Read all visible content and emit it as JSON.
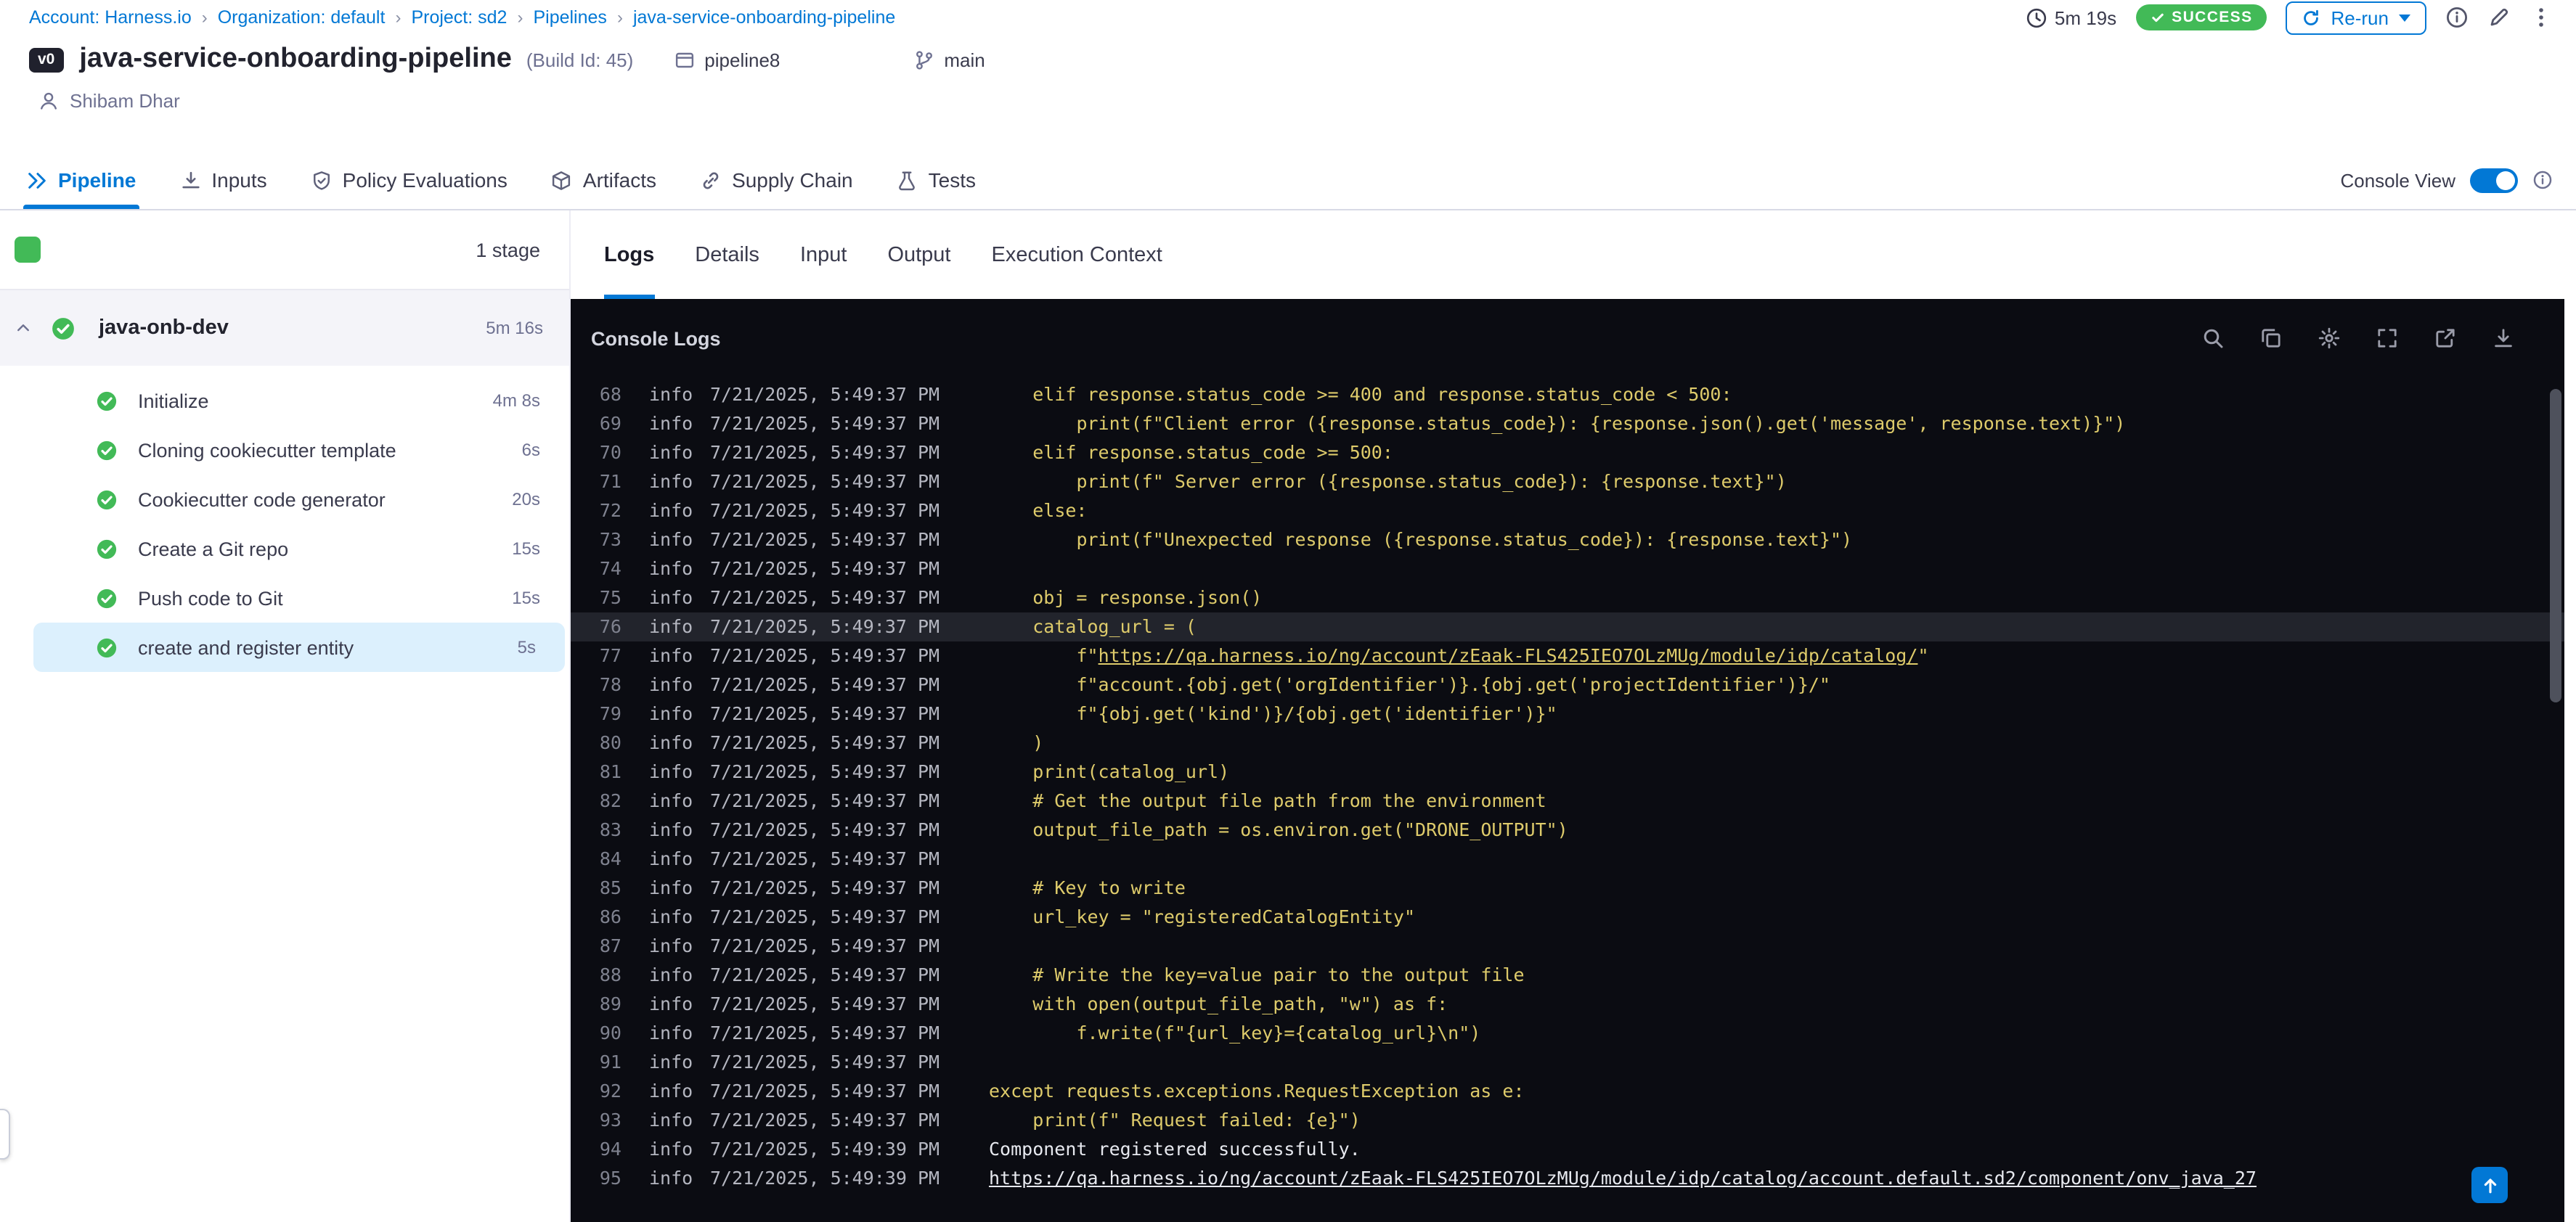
{
  "colors": {
    "accent": "#0278d5",
    "success_green": "#42ba57",
    "log_yellow": "#decb6b",
    "console_bg": "#0b0c12",
    "line_highlight": "#22242c",
    "selected_step_bg": "#dcf0fd"
  },
  "breadcrumb": {
    "separator": "›",
    "items": [
      "Account: Harness.io",
      "Organization: default",
      "Project: sd2",
      "Pipelines",
      "java-service-onboarding-pipeline"
    ]
  },
  "topbar": {
    "duration": "5m 19s",
    "status": "SUCCESS",
    "rerun_label": "Re-run"
  },
  "header": {
    "version_badge": "v0",
    "title": "java-service-onboarding-pipeline",
    "build_id": "(Build Id: 45)",
    "pipeline_tag": "pipeline8",
    "branch": "main",
    "user": "Shibam Dhar"
  },
  "tabs": {
    "console_view_label": "Console View",
    "console_view_on": true,
    "items": [
      {
        "label": "Pipeline",
        "icon": "pipeline-icon",
        "active": true
      },
      {
        "label": "Inputs",
        "icon": "inputs-icon",
        "active": false
      },
      {
        "label": "Policy Evaluations",
        "icon": "policy-evaluations-icon",
        "active": false
      },
      {
        "label": "Artifacts",
        "icon": "artifacts-icon",
        "active": false
      },
      {
        "label": "Supply Chain",
        "icon": "supply-chain-icon",
        "active": false
      },
      {
        "label": "Tests",
        "icon": "tests-icon",
        "active": false
      }
    ]
  },
  "stages": {
    "count_label": "1 stage",
    "group": {
      "name": "java-onb-dev",
      "duration": "5m 16s",
      "status": "success"
    },
    "steps": [
      {
        "name": "Initialize",
        "duration": "4m 8s",
        "status": "success",
        "selected": false
      },
      {
        "name": "Cloning cookiecutter template",
        "duration": "6s",
        "status": "success",
        "selected": false
      },
      {
        "name": "Cookiecutter code generator",
        "duration": "20s",
        "status": "success",
        "selected": false
      },
      {
        "name": "Create a Git repo",
        "duration": "15s",
        "status": "success",
        "selected": false
      },
      {
        "name": "Push code to Git",
        "duration": "15s",
        "status": "success",
        "selected": false
      },
      {
        "name": "create and register entity",
        "duration": "5s",
        "status": "success",
        "selected": true
      }
    ]
  },
  "detail_tabs": {
    "items": [
      {
        "label": "Logs",
        "active": true
      },
      {
        "label": "Details",
        "active": false
      },
      {
        "label": "Input",
        "active": false
      },
      {
        "label": "Output",
        "active": false
      },
      {
        "label": "Execution Context",
        "active": false
      }
    ]
  },
  "console": {
    "title": "Console Logs",
    "actions": [
      {
        "name": "search-icon"
      },
      {
        "name": "copy-icon"
      },
      {
        "name": "settings-icon"
      },
      {
        "name": "fullscreen-icon"
      },
      {
        "name": "open-in-new-icon"
      },
      {
        "name": "download-icon"
      }
    ],
    "lines": [
      {
        "n": 68,
        "level": "info",
        "time": "7/21/2025, 5:49:37 PM",
        "indent": 4,
        "highlight": false,
        "segs": [
          {
            "k": "code",
            "t": "elif response.status_code >= 400 and response.status_code < 500:"
          }
        ]
      },
      {
        "n": 69,
        "level": "info",
        "time": "7/21/2025, 5:49:37 PM",
        "indent": 8,
        "highlight": false,
        "segs": [
          {
            "k": "code",
            "t": "print(f\"Client error ({response.status_code}): {response.json().get('message', response.text)}\")"
          }
        ]
      },
      {
        "n": 70,
        "level": "info",
        "time": "7/21/2025, 5:49:37 PM",
        "indent": 4,
        "highlight": false,
        "segs": [
          {
            "k": "code",
            "t": "elif response.status_code >= 500:"
          }
        ]
      },
      {
        "n": 71,
        "level": "info",
        "time": "7/21/2025, 5:49:37 PM",
        "indent": 8,
        "highlight": false,
        "segs": [
          {
            "k": "code",
            "t": "print(f\" Server error ({response.status_code}): {response.text}\")"
          }
        ]
      },
      {
        "n": 72,
        "level": "info",
        "time": "7/21/2025, 5:49:37 PM",
        "indent": 4,
        "highlight": false,
        "segs": [
          {
            "k": "code",
            "t": "else:"
          }
        ]
      },
      {
        "n": 73,
        "level": "info",
        "time": "7/21/2025, 5:49:37 PM",
        "indent": 8,
        "highlight": false,
        "segs": [
          {
            "k": "code",
            "t": "print(f\"Unexpected response ({response.status_code}): {response.text}\")"
          }
        ]
      },
      {
        "n": 74,
        "level": "info",
        "time": "7/21/2025, 5:49:37 PM",
        "indent": 0,
        "highlight": false,
        "segs": []
      },
      {
        "n": 75,
        "level": "info",
        "time": "7/21/2025, 5:49:37 PM",
        "indent": 4,
        "highlight": false,
        "segs": [
          {
            "k": "code",
            "t": "obj = response.json()"
          }
        ]
      },
      {
        "n": 76,
        "level": "info",
        "time": "7/21/2025, 5:49:37 PM",
        "indent": 4,
        "highlight": true,
        "segs": [
          {
            "k": "code",
            "t": "catalog_url = ("
          }
        ]
      },
      {
        "n": 77,
        "level": "info",
        "time": "7/21/2025, 5:49:37 PM",
        "indent": 8,
        "highlight": false,
        "segs": [
          {
            "k": "code",
            "t": "f\""
          },
          {
            "k": "code-link",
            "t": "https://qa.harness.io/ng/account/zEaak-FLS425IEO7OLzMUg/module/idp/catalog/"
          },
          {
            "k": "code",
            "t": "\""
          }
        ]
      },
      {
        "n": 78,
        "level": "info",
        "time": "7/21/2025, 5:49:37 PM",
        "indent": 8,
        "highlight": false,
        "segs": [
          {
            "k": "code",
            "t": "f\"account.{obj.get('orgIdentifier')}.{obj.get('projectIdentifier')}/\""
          }
        ]
      },
      {
        "n": 79,
        "level": "info",
        "time": "7/21/2025, 5:49:37 PM",
        "indent": 8,
        "highlight": false,
        "segs": [
          {
            "k": "code",
            "t": "f\"{obj.get('kind')}/{obj.get('identifier')}\""
          }
        ]
      },
      {
        "n": 80,
        "level": "info",
        "time": "7/21/2025, 5:49:37 PM",
        "indent": 4,
        "highlight": false,
        "segs": [
          {
            "k": "code",
            "t": ")"
          }
        ]
      },
      {
        "n": 81,
        "level": "info",
        "time": "7/21/2025, 5:49:37 PM",
        "indent": 4,
        "highlight": false,
        "segs": [
          {
            "k": "code",
            "t": "print(catalog_url)"
          }
        ]
      },
      {
        "n": 82,
        "level": "info",
        "time": "7/21/2025, 5:49:37 PM",
        "indent": 4,
        "highlight": false,
        "segs": [
          {
            "k": "code",
            "t": "# Get the output file path from the environment"
          }
        ]
      },
      {
        "n": 83,
        "level": "info",
        "time": "7/21/2025, 5:49:37 PM",
        "indent": 4,
        "highlight": false,
        "segs": [
          {
            "k": "code",
            "t": "output_file_path = os.environ.get(\"DRONE_OUTPUT\")"
          }
        ]
      },
      {
        "n": 84,
        "level": "info",
        "time": "7/21/2025, 5:49:37 PM",
        "indent": 0,
        "highlight": false,
        "segs": []
      },
      {
        "n": 85,
        "level": "info",
        "time": "7/21/2025, 5:49:37 PM",
        "indent": 4,
        "highlight": false,
        "segs": [
          {
            "k": "code",
            "t": "# Key to write"
          }
        ]
      },
      {
        "n": 86,
        "level": "info",
        "time": "7/21/2025, 5:49:37 PM",
        "indent": 4,
        "highlight": false,
        "segs": [
          {
            "k": "code",
            "t": "url_key = \"registeredCatalogEntity\""
          }
        ]
      },
      {
        "n": 87,
        "level": "info",
        "time": "7/21/2025, 5:49:37 PM",
        "indent": 0,
        "highlight": false,
        "segs": []
      },
      {
        "n": 88,
        "level": "info",
        "time": "7/21/2025, 5:49:37 PM",
        "indent": 4,
        "highlight": false,
        "segs": [
          {
            "k": "code",
            "t": "# Write the key=value pair to the output file"
          }
        ]
      },
      {
        "n": 89,
        "level": "info",
        "time": "7/21/2025, 5:49:37 PM",
        "indent": 4,
        "highlight": false,
        "segs": [
          {
            "k": "code",
            "t": "with open(output_file_path, \"w\") as f:"
          }
        ]
      },
      {
        "n": 90,
        "level": "info",
        "time": "7/21/2025, 5:49:37 PM",
        "indent": 8,
        "highlight": false,
        "segs": [
          {
            "k": "code",
            "t": "f.write(f\"{url_key}={catalog_url}\\n\")"
          }
        ]
      },
      {
        "n": 91,
        "level": "info",
        "time": "7/21/2025, 5:49:37 PM",
        "indent": 0,
        "highlight": false,
        "segs": []
      },
      {
        "n": 92,
        "level": "info",
        "time": "7/21/2025, 5:49:37 PM",
        "indent": 0,
        "highlight": false,
        "segs": [
          {
            "k": "code",
            "t": "except requests.exceptions.RequestException as e:"
          }
        ]
      },
      {
        "n": 93,
        "level": "info",
        "time": "7/21/2025, 5:49:37 PM",
        "indent": 4,
        "highlight": false,
        "segs": [
          {
            "k": "code",
            "t": "print(f\" Request failed: {e}\")"
          }
        ]
      },
      {
        "n": 94,
        "level": "info",
        "time": "7/21/2025, 5:49:39 PM",
        "indent": 0,
        "highlight": false,
        "segs": [
          {
            "k": "out",
            "t": "Component registered successfully."
          }
        ]
      },
      {
        "n": 95,
        "level": "info",
        "time": "7/21/2025, 5:49:39 PM",
        "indent": 0,
        "highlight": false,
        "segs": [
          {
            "k": "out-link",
            "t": "https://qa.harness.io/ng/account/zEaak-FLS425IEO7OLzMUg/module/idp/catalog/account.default.sd2/component/onv_java_27"
          }
        ]
      }
    ]
  }
}
